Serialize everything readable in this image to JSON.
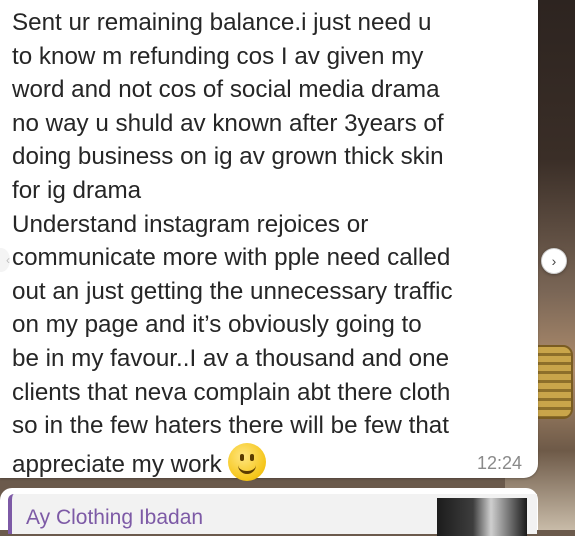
{
  "message": {
    "lines": [
      "Sent ur remaining balance.i just need u",
      "to know m refunding cos I av given my",
      "word and not cos of social media drama",
      "no way u shuld av known after 3years of",
      "doing business on ig av grown thick skin",
      "for ig drama",
      "Understand instagram rejoices or",
      "communicate more with pple need called",
      "out an just getting the unnecessary traffic",
      "on my page and it’s obviously going to",
      "be in my favour..I av a thousand and one",
      "clients that neva complain abt there cloth",
      "so in the few haters there will be few that",
      "appreciate my work"
    ],
    "emoji": "smiling-face",
    "time": "12:24"
  },
  "reply": {
    "sender": "Ay Clothing Ibadan"
  },
  "nav": {
    "next": "›",
    "prev": "‹"
  },
  "colors": {
    "reply_accent": "#7d5aa6",
    "bubble": "#ffffff"
  }
}
